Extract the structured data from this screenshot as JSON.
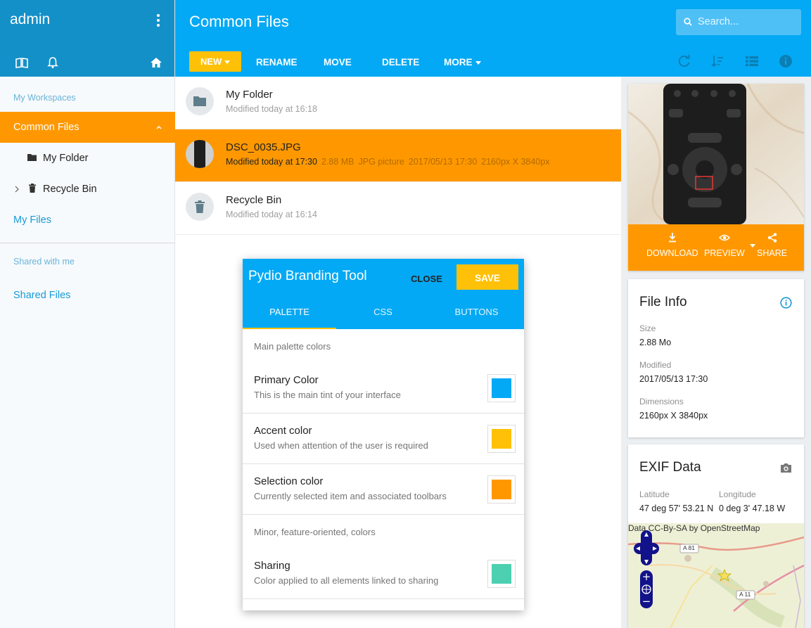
{
  "sidebar": {
    "username": "admin",
    "section_workspaces": "My Workspaces",
    "common_files": "Common Files",
    "my_folder": "My Folder",
    "recycle_bin": "Recycle Bin",
    "my_files": "My Files",
    "section_shared": "Shared with me",
    "shared_files": "Shared Files"
  },
  "header": {
    "title": "Common Files",
    "search_placeholder": "Search...",
    "new_label": "NEW",
    "rename_label": "RENAME",
    "move_label": "MOVE",
    "delete_label": "DELETE",
    "more_label": "MORE"
  },
  "files": [
    {
      "name": "My Folder",
      "modified": "Modified today at 16:18"
    },
    {
      "name": "DSC_0035.JPG",
      "modified": "Modified today at 17:30",
      "size": "2.88 MB",
      "type": "JPG picture",
      "date": "2017/05/13 17:30",
      "dims": "2160px X 3840px"
    },
    {
      "name": "Recycle Bin",
      "modified": "Modified today at 16:14"
    }
  ],
  "preview": {
    "download": "DOWNLOAD",
    "preview": "PREVIEW",
    "share": "SHARE"
  },
  "file_info": {
    "title": "File Info",
    "size_label": "Size",
    "size_value": "2.88 Mo",
    "modified_label": "Modified",
    "modified_value": "2017/05/13 17:30",
    "dimensions_label": "Dimensions",
    "dimensions_value": "2160px X 3840px"
  },
  "exif": {
    "title": "EXIF Data",
    "latitude_label": "Latitude",
    "latitude_value": "47 deg 57' 53.21 N",
    "longitude_label": "Longitude",
    "longitude_value": "0 deg 3' 47.18 W",
    "map_credit": "Data CC-By-SA by OpenStreetMap",
    "road_1": "A 81",
    "road_2": "A 11"
  },
  "branding_dialog": {
    "title": "Pydio Branding Tool",
    "close": "CLOSE",
    "save": "SAVE",
    "tabs": [
      "PALETTE",
      "CSS",
      "BUTTONS"
    ],
    "section_main": "Main palette colors",
    "section_minor": "Minor, feature-oriented, colors",
    "colors": [
      {
        "name": "Primary Color",
        "desc": "This is the main tint of your interface",
        "color": "#03a9f4"
      },
      {
        "name": "Accent color",
        "desc": "Used when attention of the user is required",
        "color": "#ffc107"
      },
      {
        "name": "Selection color",
        "desc": "Currently selected item and associated toolbars",
        "color": "#ff9800"
      },
      {
        "name": "Sharing",
        "desc": "Color applied to all elements linked to sharing",
        "color": "#4dd0b1"
      }
    ]
  },
  "theme": {
    "primary": "#03a9f4",
    "accent": "#ffc107",
    "selection": "#ff9800",
    "sidebar_header": "#1490c8"
  },
  "icons": [
    "book-icon",
    "bell-icon",
    "home-icon",
    "search-icon",
    "refresh-icon",
    "sort-icon",
    "list-view-icon",
    "info-icon",
    "folder-icon",
    "trash-icon",
    "download-icon",
    "eye-icon",
    "share-icon",
    "camera-icon",
    "chevron-up-icon",
    "chevron-right-icon",
    "more-vert-icon"
  ]
}
